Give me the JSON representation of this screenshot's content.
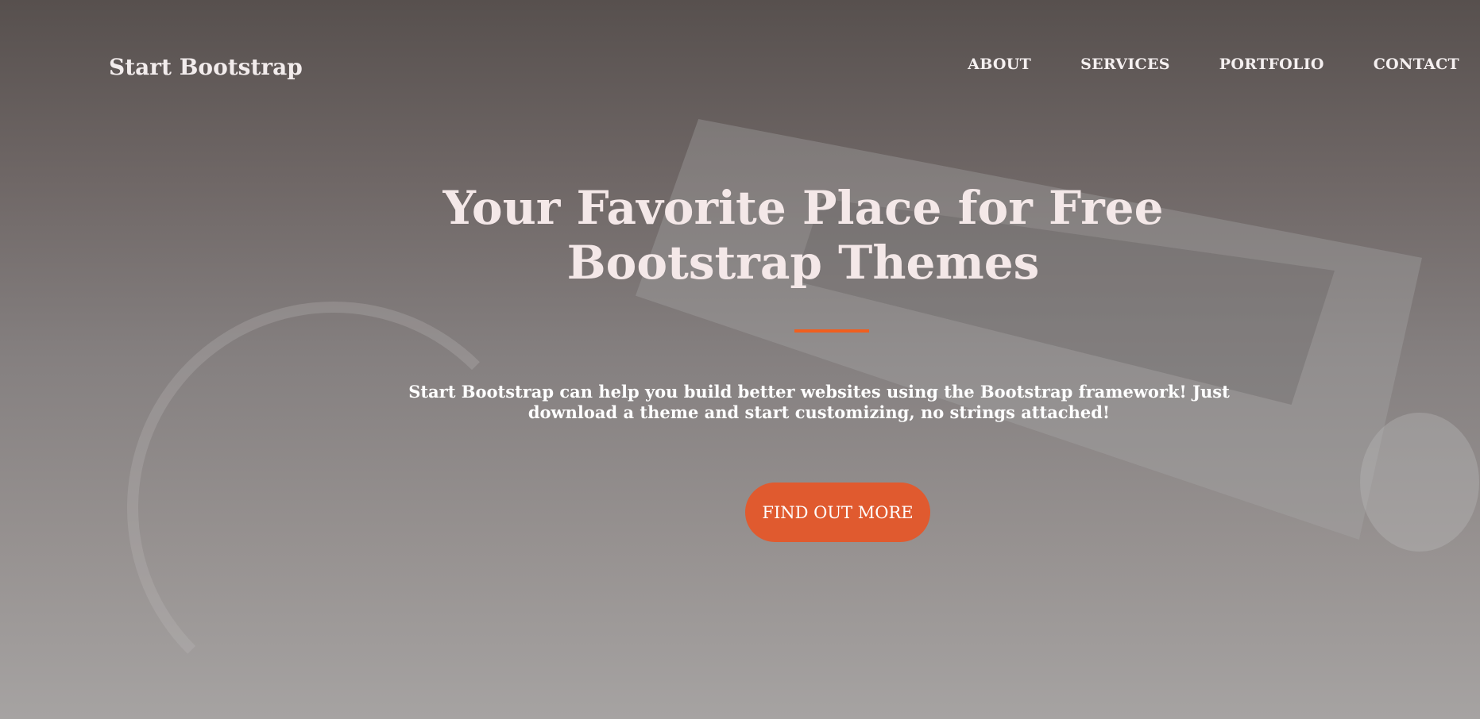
{
  "navbar": {
    "brand": "Start Bootstrap",
    "links": [
      "ABOUT",
      "SERVICES",
      "PORTFOLIO",
      "CONTACT"
    ]
  },
  "hero": {
    "title": "Your Favorite Place for Free Bootstrap Themes",
    "subtitle": "Start Bootstrap can help you build better websites using the Bootstrap framework! Just download a theme and start customizing, no strings attached!",
    "cta": "FIND OUT MORE"
  },
  "colors": {
    "accent": "#f05f1f",
    "button": "#e05a2f"
  }
}
